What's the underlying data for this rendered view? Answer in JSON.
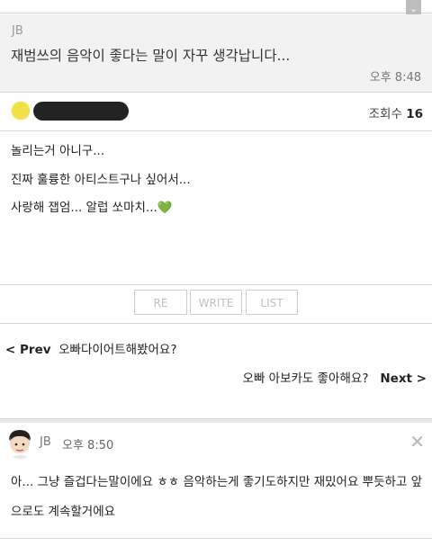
{
  "reply": {
    "author": "JB",
    "text": "재범쓰의 음악이 좋다는 말이 자꾸 생각납니다...",
    "time": "오후 8:48"
  },
  "post": {
    "views_label": "조회수",
    "views": "16",
    "lines": [
      "놀리는거 아니구...",
      "진짜 훌륭한 아티스트구나 싶어서...",
      "사랑해 잽엄... 알럽 쏘마치..."
    ],
    "heart": "💚"
  },
  "buttons": {
    "re": "RE",
    "write": "WRITE",
    "list": "LIST"
  },
  "nav": {
    "prev_label": "< Prev",
    "prev_title": "오빠다이어트해봤어요?",
    "next_title": "오빠 아보카도 좋아해요?",
    "next_label": "Next >"
  },
  "comment": {
    "author": "JB",
    "time": "오후 8:50",
    "text": "아... 그냥 즐겁다는말이에요 ㅎㅎ 음악하는게 좋기도하지만 재밌어요 뿌듯하고 앞으로도 계속할거에요",
    "close": "✕"
  },
  "icons": {
    "scroll": "chevron-down-icon",
    "close": "close-icon"
  }
}
